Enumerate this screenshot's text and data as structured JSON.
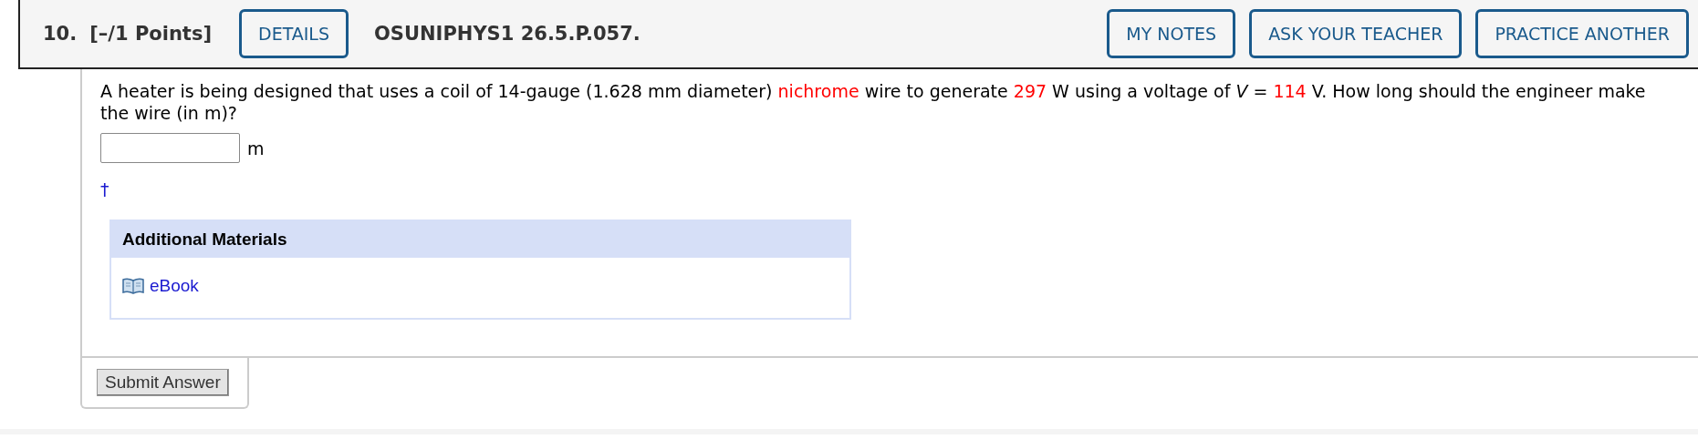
{
  "question": {
    "number": "10.",
    "points": "[–/1 Points]",
    "details_button": "DETAILS",
    "code": "OSUNIPHYS1 26.5.P.057.",
    "actions": [
      "MY NOTES",
      "ASK YOUR TEACHER",
      "PRACTICE ANOTHER"
    ]
  },
  "prompt": [
    {
      "text": "A heater is being designed that uses a coil of 14-gauge (1.628 mm diameter) ",
      "highlight": false
    },
    {
      "text": "nichrome",
      "highlight": true
    },
    {
      "text": " wire to generate ",
      "highlight": false
    },
    {
      "text": "297",
      "highlight": true
    },
    {
      "text": " W using a voltage of *V* = ",
      "highlight": false
    },
    {
      "text": "114",
      "highlight": true
    },
    {
      "text": " V. How long should the engineer make the wire (in m)?",
      "highlight": false
    }
  ],
  "answer": {
    "unit": "m"
  },
  "footnote_mark": "†",
  "materials": {
    "title": "Additional Materials",
    "links": [
      "eBook"
    ]
  },
  "submit_button": "Submit Answer"
}
